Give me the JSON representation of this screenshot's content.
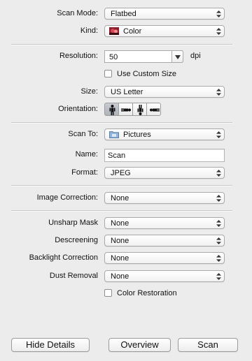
{
  "scan_mode": {
    "label": "Scan Mode:",
    "value": "Flatbed"
  },
  "kind": {
    "label": "Kind:",
    "value": "Color"
  },
  "resolution": {
    "label": "Resolution:",
    "value": "50",
    "unit": "dpi"
  },
  "custom_size": {
    "label": "Use Custom Size",
    "checked": false
  },
  "size": {
    "label": "Size:",
    "value": "US Letter"
  },
  "orientation": {
    "label": "Orientation:",
    "options": [
      "portrait-icon",
      "landscape-left-icon",
      "portrait-flipped-icon",
      "landscape-right-icon"
    ],
    "selected": 0
  },
  "scan_to": {
    "label": "Scan To:",
    "value": "Pictures"
  },
  "name": {
    "label": "Name:",
    "value": "Scan"
  },
  "format": {
    "label": "Format:",
    "value": "JPEG"
  },
  "image_correction": {
    "label": "Image Correction:",
    "value": "None"
  },
  "unsharp_mask": {
    "label": "Unsharp Mask",
    "value": "None"
  },
  "descreening": {
    "label": "Descreening",
    "value": "None"
  },
  "backlight": {
    "label": "Backlight Correction",
    "value": "None"
  },
  "dust": {
    "label": "Dust Removal",
    "value": "None"
  },
  "color_restoration": {
    "label": "Color Restoration",
    "checked": false
  },
  "buttons": {
    "hide_details": "Hide Details",
    "overview": "Overview",
    "scan": "Scan"
  }
}
